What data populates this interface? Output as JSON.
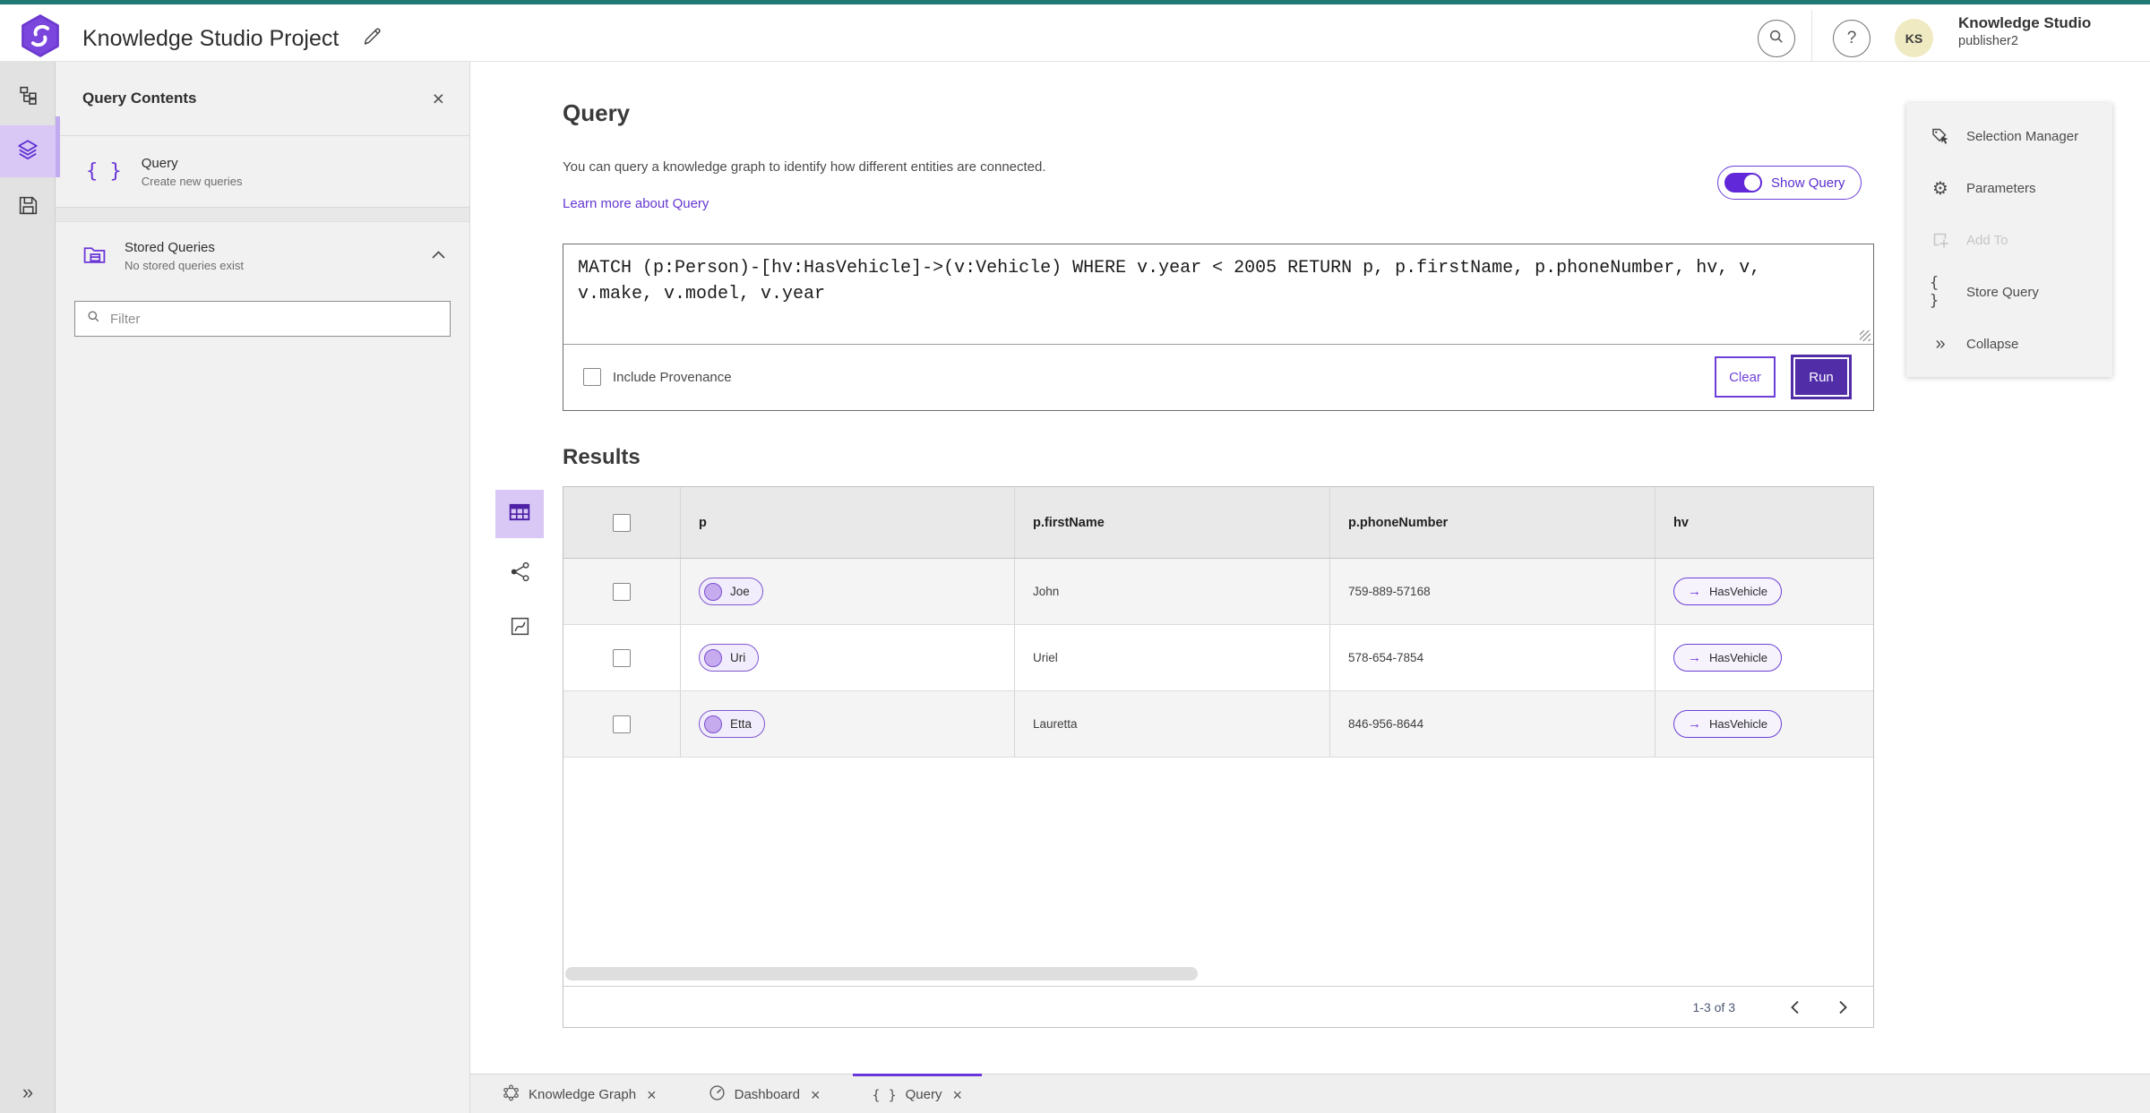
{
  "header": {
    "title": "Knowledge Studio Project",
    "product_name": "Knowledge Studio",
    "username": "publisher2",
    "avatar_initials": "KS"
  },
  "colors": {
    "teal_top_border": "#217975",
    "accent_purple": "#6a35d9",
    "run_button_fill": "#512da8",
    "active_highlight": "#d9c7f6",
    "node_pill_border": "#7e57cf"
  },
  "glyphs": {
    "close": "×",
    "help": "?",
    "braces": "{ }",
    "arrow_right": "→",
    "collapse_chevrons": "»",
    "gear": "⚙"
  },
  "contents_panel": {
    "title": "Query Contents",
    "query_item": {
      "title": "Query",
      "subtitle": "Create new queries"
    },
    "stored_item": {
      "title": "Stored Queries",
      "subtitle": "No stored queries exist"
    },
    "filter_placeholder": "Filter"
  },
  "query_section": {
    "title": "Query",
    "description": "You can query a knowledge graph to identify how different entities are connected.",
    "learn_more": "Learn more about Query",
    "show_query_label": "Show Query",
    "query_text": "MATCH (p:Person)-[hv:HasVehicle]->(v:Vehicle) WHERE v.year < 2005 RETURN p, p.firstName, p.phoneNumber, hv, v, v.make, v.model, v.year",
    "include_provenance_label": "Include Provenance",
    "clear_label": "Clear",
    "run_label": "Run"
  },
  "results": {
    "title": "Results",
    "columns": [
      "p",
      "p.firstName",
      "p.phoneNumber",
      "hv"
    ],
    "rows": [
      {
        "p": "Joe",
        "firstName": "John",
        "phoneNumber": "759-889-57168",
        "hv": "HasVehicle"
      },
      {
        "p": "Uri",
        "firstName": "Uriel",
        "phoneNumber": "578-654-7854",
        "hv": "HasVehicle"
      },
      {
        "p": "Etta",
        "firstName": "Lauretta",
        "phoneNumber": "846-956-8644",
        "hv": "HasVehicle"
      }
    ],
    "pagination": "1-3 of 3"
  },
  "actions_panel": {
    "items": [
      {
        "label": "Selection Manager",
        "icon": "selection-manager-icon",
        "disabled": false
      },
      {
        "label": "Parameters",
        "icon": "parameters-gear-icon",
        "disabled": false
      },
      {
        "label": "Add To",
        "icon": "add-to-icon",
        "disabled": true
      },
      {
        "label": "Store Query",
        "icon": "store-query-braces-icon",
        "disabled": false
      },
      {
        "label": "Collapse",
        "icon": "collapse-chevrons-icon",
        "disabled": false
      }
    ]
  },
  "tabs": [
    {
      "label": "Knowledge Graph",
      "icon": "knowledge-graph-icon",
      "active": false
    },
    {
      "label": "Dashboard",
      "icon": "dashboard-gauge-icon",
      "active": false
    },
    {
      "label": "Query",
      "icon": "query-braces-icon",
      "active": true
    }
  ]
}
